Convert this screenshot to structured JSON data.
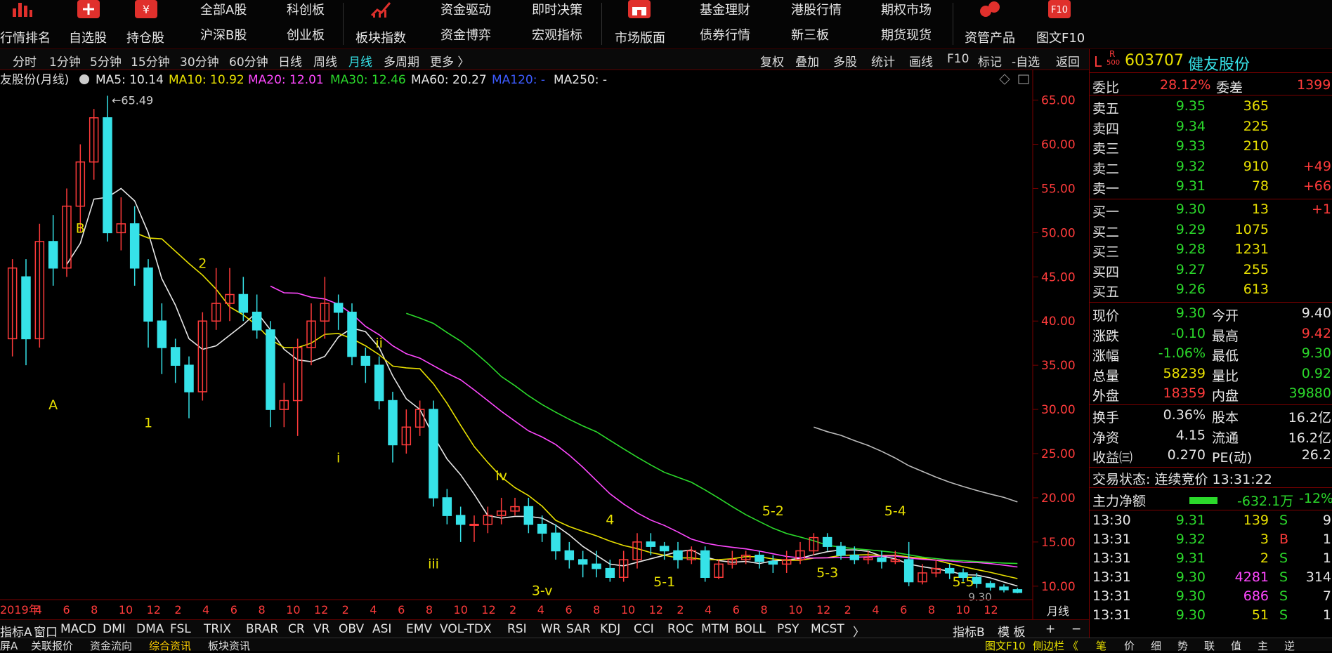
{
  "toolbar": {
    "items": [
      {
        "label": "行情排名",
        "icon": "bar-chart-icon"
      },
      {
        "label": "自选股",
        "icon": "plus-icon"
      },
      {
        "label": "持仓股",
        "icon": "yen-icon"
      },
      {
        "label": "全部A股"
      },
      {
        "label": "沪深B股"
      },
      {
        "label": "科创板"
      },
      {
        "label": "创业板"
      },
      {
        "label": "板块指数",
        "icon": "trend-icon"
      },
      {
        "label": "资金驱动"
      },
      {
        "label": "资金博弈"
      },
      {
        "label": "即时决策"
      },
      {
        "label": "宏观指标"
      },
      {
        "label": "市场版面",
        "icon": "store-icon"
      },
      {
        "label": "基金理财"
      },
      {
        "label": "债券行情"
      },
      {
        "label": "港股行情"
      },
      {
        "label": "新三板"
      },
      {
        "label": "期权市场"
      },
      {
        "label": "期货现货"
      },
      {
        "label": "资管产品",
        "icon": "coins-icon"
      },
      {
        "label": "图文F10",
        "icon": "f10-icon"
      }
    ]
  },
  "periods": [
    "分时",
    "1分钟",
    "5分钟",
    "15分钟",
    "30分钟",
    "60分钟",
    "日线",
    "周线",
    "月线",
    "多周期",
    "更多 〉"
  ],
  "active_period": "月线",
  "chart_tools": [
    "复权",
    "叠加",
    "多股",
    "统计",
    "画线",
    "F10",
    "标记",
    "-自选",
    "返回"
  ],
  "ma_legend": {
    "name": "友股份(月线)",
    "ma5": "MA5: 10.14",
    "ma10": "MA10: 10.92",
    "ma20": "MA20: 12.01",
    "ma30": "MA30: 12.46",
    "ma60": "MA60: 20.27",
    "ma120": "MA120: -",
    "ma250": "MA250: -"
  },
  "colors": {
    "up": "#ff3b3b",
    "down": "#36e2e8",
    "ma5": "#e6e6e6",
    "ma10": "#e8e000",
    "ma20": "#ff48ff",
    "ma30": "#2bd92b",
    "ma60": "#e6e6e6",
    "grid": "#7a0000"
  },
  "chart_data": {
    "type": "candlestick",
    "ylim": [
      8,
      66
    ],
    "y_ticks": [
      "65.00",
      "60.00",
      "55.00",
      "50.00",
      "45.00",
      "40.00",
      "35.00",
      "30.00",
      "25.00",
      "20.00",
      "15.00",
      "10.00"
    ],
    "x_ticks": [
      "2019年",
      "4",
      "6",
      "8",
      "10",
      "12",
      "2",
      "4",
      "6",
      "8",
      "10",
      "12",
      "2",
      "4",
      "6",
      "8",
      "10",
      "12",
      "2",
      "4",
      "6",
      "8",
      "10",
      "12",
      "2",
      "4",
      "6",
      "8",
      "10",
      "12",
      "2",
      "4",
      "6",
      "8",
      "10",
      "12"
    ],
    "x_unit": "月线",
    "high_label": "65.49",
    "last_label": "9.30",
    "wave_labels": [
      "B",
      "A",
      "2",
      "1",
      "ii",
      "i",
      "iv",
      "iii",
      "4",
      "3-v",
      "5-2",
      "5-1",
      "5-4",
      "5-3",
      "5-5"
    ],
    "candles": [
      [
        38,
        46,
        36,
        47
      ],
      [
        45,
        38,
        35,
        47
      ],
      [
        38,
        49,
        37,
        51
      ],
      [
        49,
        46,
        44,
        52
      ],
      [
        46,
        53,
        45,
        55
      ],
      [
        53,
        58,
        50,
        60
      ],
      [
        58,
        63,
        56,
        64
      ],
      [
        63,
        50,
        49,
        65.49
      ],
      [
        50,
        51,
        48,
        54
      ],
      [
        51,
        46,
        44,
        53
      ],
      [
        46,
        40,
        37,
        47
      ],
      [
        40,
        37,
        34,
        42
      ],
      [
        37,
        35,
        33,
        38
      ],
      [
        35,
        32,
        29,
        36
      ],
      [
        32,
        40,
        31,
        41
      ],
      [
        40,
        42,
        39,
        46
      ],
      [
        42,
        43,
        40,
        46
      ],
      [
        43,
        41,
        40,
        45
      ],
      [
        41,
        39,
        38,
        43
      ],
      [
        39,
        30,
        28,
        40
      ],
      [
        30,
        31,
        28,
        33
      ],
      [
        31,
        37,
        27,
        38
      ],
      [
        37,
        40,
        35,
        42
      ],
      [
        40,
        42,
        38,
        45
      ],
      [
        42,
        41,
        39,
        43
      ],
      [
        41,
        36,
        35,
        42
      ],
      [
        36,
        35,
        33,
        37
      ],
      [
        35,
        31,
        30,
        36
      ],
      [
        31,
        26,
        24,
        32
      ],
      [
        26,
        28,
        25,
        30
      ],
      [
        28,
        30,
        27,
        31
      ],
      [
        30,
        20,
        19,
        31
      ],
      [
        20,
        18,
        17,
        21
      ],
      [
        18,
        17,
        15,
        19
      ],
      [
        17,
        17,
        15,
        18
      ],
      [
        17,
        18,
        16,
        19
      ],
      [
        18,
        18.5,
        17,
        20
      ],
      [
        18.5,
        19,
        18,
        20
      ],
      [
        19,
        17,
        16,
        20
      ],
      [
        17,
        16,
        15,
        18
      ],
      [
        16,
        14,
        13,
        17
      ],
      [
        14,
        13,
        12,
        15
      ],
      [
        13,
        12.5,
        11,
        14
      ],
      [
        12.5,
        12,
        11,
        14
      ],
      [
        12,
        11,
        10.5,
        13
      ],
      [
        11,
        13,
        10.5,
        14
      ],
      [
        13,
        15,
        12,
        16
      ],
      [
        15,
        14.5,
        13.5,
        16
      ],
      [
        14.5,
        14,
        13,
        15
      ],
      [
        14,
        13,
        12,
        15
      ],
      [
        13,
        14,
        12.5,
        14.5
      ],
      [
        14,
        11,
        10.5,
        14.5
      ],
      [
        11,
        12.5,
        10.8,
        13
      ],
      [
        12.5,
        13,
        12,
        14
      ],
      [
        13,
        13.5,
        12.5,
        14
      ],
      [
        13.5,
        12.8,
        12,
        14
      ],
      [
        12.8,
        12.5,
        11.5,
        13.5
      ],
      [
        12.5,
        13,
        11.5,
        14
      ],
      [
        13,
        14,
        12.5,
        15
      ],
      [
        14,
        15.5,
        13.5,
        16
      ],
      [
        15.5,
        14.5,
        14,
        16
      ],
      [
        14.5,
        13.5,
        13,
        15
      ],
      [
        13.5,
        13,
        12.5,
        14.5
      ],
      [
        13,
        13.2,
        12.5,
        14
      ],
      [
        13.2,
        12.8,
        12,
        14
      ],
      [
        12.8,
        13,
        12.5,
        14
      ],
      [
        13,
        10.5,
        10,
        15
      ],
      [
        10.5,
        11.5,
        10.2,
        12.5
      ],
      [
        11.5,
        12,
        11,
        13
      ],
      [
        12,
        11.5,
        10.8,
        12.5
      ],
      [
        11.5,
        11,
        10.5,
        12
      ],
      [
        11,
        10.3,
        9.8,
        11.5
      ],
      [
        10.3,
        9.9,
        9.5,
        10.6
      ],
      [
        9.9,
        9.6,
        9.3,
        10.2
      ],
      [
        9.6,
        9.3,
        9.2,
        9.8
      ]
    ]
  },
  "indicators": [
    "指标A",
    "窗口",
    "MACD",
    "DMI",
    "DMA",
    "FSL",
    "TRIX",
    "BRAR",
    "CR",
    "VR",
    "OBV",
    "ASI",
    "EMV",
    "VOL-TDX",
    "RSI",
    "WR",
    "SAR",
    "KDJ",
    "CCI",
    "ROC",
    "MTM",
    "BOLL",
    "PSY",
    "MCST",
    "〉"
  ],
  "indicator_right": [
    "指标B",
    "模 板",
    "+",
    "−"
  ],
  "bottom_tabs": [
    "屏A",
    "关联报价",
    "资金流向",
    "综合资讯",
    "板块资讯"
  ],
  "bottom_right": [
    "图文F10",
    "侧边栏 《",
    "笔",
    "价",
    "细",
    "势",
    "联",
    "值",
    "主",
    "逆"
  ],
  "stock": {
    "market": "L",
    "badge": "R",
    "badge_sub": "500",
    "code": "603707",
    "name": "健友股份"
  },
  "ratio": {
    "label1": "委比",
    "value1": "28.12%",
    "label2": "委差",
    "value2": "1399"
  },
  "sell": [
    {
      "label": "卖五",
      "price": "9.35",
      "vol": "365",
      "chg": ""
    },
    {
      "label": "卖四",
      "price": "9.34",
      "vol": "225",
      "chg": ""
    },
    {
      "label": "卖三",
      "price": "9.33",
      "vol": "210",
      "chg": ""
    },
    {
      "label": "卖二",
      "price": "9.32",
      "vol": "910",
      "chg": "+49"
    },
    {
      "label": "卖一",
      "price": "9.31",
      "vol": "78",
      "chg": "+66"
    }
  ],
  "buy": [
    {
      "label": "买一",
      "price": "9.30",
      "vol": "13",
      "chg": "+1"
    },
    {
      "label": "买二",
      "price": "9.29",
      "vol": "1075",
      "chg": ""
    },
    {
      "label": "买三",
      "price": "9.28",
      "vol": "1231",
      "chg": ""
    },
    {
      "label": "买四",
      "price": "9.27",
      "vol": "255",
      "chg": ""
    },
    {
      "label": "买五",
      "price": "9.26",
      "vol": "613",
      "chg": ""
    }
  ],
  "quote": [
    {
      "l1": "现价",
      "v1": "9.30",
      "c1": "green",
      "l2": "今开",
      "v2": "9.40",
      "c2": "white"
    },
    {
      "l1": "涨跌",
      "v1": "-0.10",
      "c1": "green",
      "l2": "最高",
      "v2": "9.42",
      "c2": "red"
    },
    {
      "l1": "涨幅",
      "v1": "-1.06%",
      "c1": "green",
      "l2": "最低",
      "v2": "9.30",
      "c2": "green"
    },
    {
      "l1": "总量",
      "v1": "58239",
      "c1": "yellow",
      "l2": "量比",
      "v2": "0.92",
      "c2": "green"
    },
    {
      "l1": "外盘",
      "v1": "18359",
      "c1": "red",
      "l2": "内盘",
      "v2": "39880",
      "c2": "green"
    }
  ],
  "fund": [
    {
      "l1": "换手",
      "v1": "0.36%",
      "l2": "股本",
      "v2": "16.2亿"
    },
    {
      "l1": "净资",
      "v1": "4.15",
      "l2": "流通",
      "v2": "16.2亿"
    },
    {
      "l1": "收益㈢",
      "v1": "0.270",
      "l2": "PE(动)",
      "v2": "26.2"
    }
  ],
  "status": {
    "label": "交易状态: 连续竞价 13:31:22"
  },
  "main_flow": {
    "label": "主力净额",
    "value": "-632.1万",
    "pct": "-12%"
  },
  "ticks": [
    {
      "time": "13:30",
      "price": "9.31",
      "pc": "green",
      "vol": "139",
      "vc": "yellow",
      "bs": "S",
      "bc": "green",
      "n": "9"
    },
    {
      "time": "13:31",
      "price": "9.32",
      "pc": "green",
      "vol": "3",
      "vc": "yellow",
      "bs": "B",
      "bc": "red",
      "n": "1"
    },
    {
      "time": "13:31",
      "price": "9.31",
      "pc": "green",
      "vol": "2",
      "vc": "yellow",
      "bs": "S",
      "bc": "green",
      "n": "1"
    },
    {
      "time": "13:31",
      "price": "9.30",
      "pc": "green",
      "vol": "4281",
      "vc": "magenta",
      "bs": "S",
      "bc": "green",
      "n": "314"
    },
    {
      "time": "13:31",
      "price": "9.30",
      "pc": "green",
      "vol": "686",
      "vc": "magenta",
      "bs": "S",
      "bc": "green",
      "n": "7"
    },
    {
      "time": "13:31",
      "price": "9.30",
      "pc": "green",
      "vol": "51",
      "vc": "yellow",
      "bs": "S",
      "bc": "green",
      "n": "1"
    }
  ]
}
